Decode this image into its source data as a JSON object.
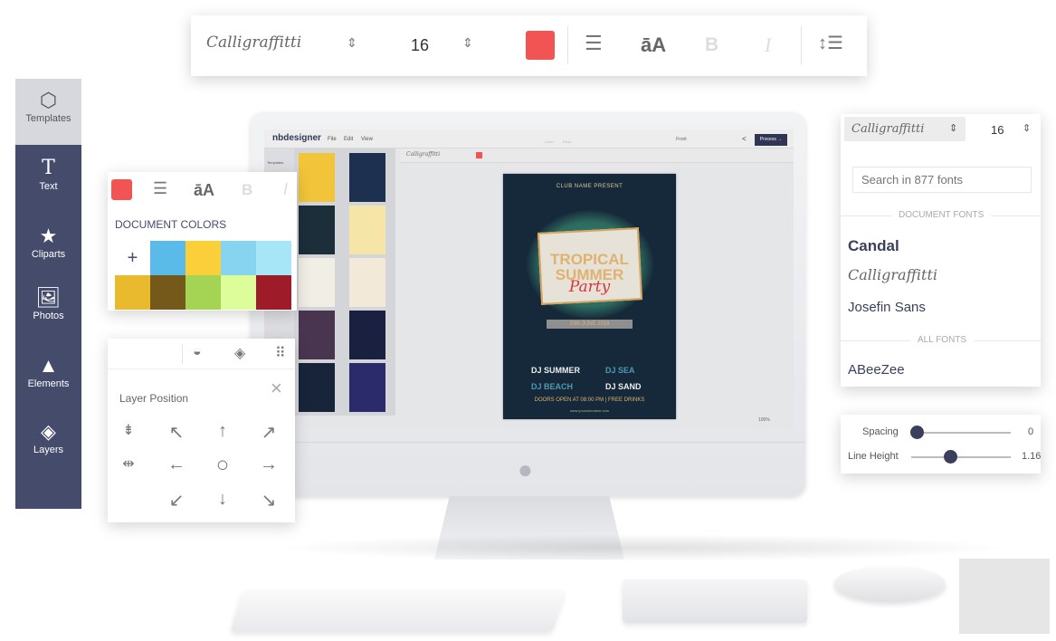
{
  "top_toolbar": {
    "font_name": "Calligraffitti",
    "font_size": "16",
    "text_color": "#f25454",
    "case_label": "āA",
    "bold_label": "B",
    "italic_label": "I",
    "icons": [
      "updown-icon",
      "align-center-icon",
      "line-height-icon"
    ]
  },
  "sidebar": {
    "items": [
      {
        "label": "Templates",
        "icon": "cube-icon",
        "active": true
      },
      {
        "label": "Text",
        "icon": "text-icon"
      },
      {
        "label": "Cliparts",
        "icon": "star-icon"
      },
      {
        "label": "Photos",
        "icon": "image-icon"
      },
      {
        "label": "Elements",
        "icon": "shapes-icon"
      },
      {
        "label": "Layers",
        "icon": "layers-icon"
      }
    ]
  },
  "color_panel": {
    "title": "DOCUMENT COLORS",
    "add_label": "+",
    "colors": [
      "#5bbbe8",
      "#fbcf3a",
      "#86d4f0",
      "#a6e6f7",
      "#e9b92e",
      "#74591b",
      "#a5d455",
      "#dcfd99",
      "#9e1b2a"
    ]
  },
  "layer_panel": {
    "title": "Layer Position",
    "close_label": "×",
    "arrows": [
      "↖",
      "↑",
      "↗",
      "←",
      "○",
      "→",
      "↙",
      "↓",
      "↘"
    ]
  },
  "app": {
    "logo": "nbdesigner",
    "menu": [
      "File",
      "Edit",
      "View"
    ],
    "undo": "Undo",
    "redo": "Redo",
    "side_label": "Front",
    "process_label": "Process →",
    "rail_label": "Templates",
    "zoom": "100%",
    "template_colors": [
      "#f2c43a",
      "#1e3050",
      "#1b2e3a",
      "#f5e6a8",
      "#f1eee6",
      "#f3e9d8",
      "#4a3550",
      "#1a2140",
      "#18243a",
      "#2b2a6b"
    ]
  },
  "poster": {
    "club": "CLUB NAME PRESENT",
    "title1": "TROPICAL",
    "title2": "SUMMER",
    "title3": "Party",
    "date": "23th JUNE 2018",
    "dj1": "DJ SUMMER",
    "dj2": "DJ SEA",
    "dj3": "DJ BEACH",
    "dj4": "DJ SAND",
    "doors": "DOORS OPEN AT 08:00 PM | FREE DRINKS",
    "url": "www.yourclubname.com"
  },
  "font_panel": {
    "font_name": "Calligraffitti",
    "font_size": "16",
    "search_placeholder": "Search in 877 fonts",
    "document_fonts_label": "DOCUMENT FONTS",
    "document_fonts": [
      "Candal",
      "Calligraffitti",
      "Josefin Sans"
    ],
    "all_fonts_label": "ALL FONTS",
    "all_fonts": [
      "ABeeZee"
    ]
  },
  "slider_panel": {
    "spacing_label": "Spacing",
    "spacing_value": "0",
    "spacing_fraction": 0,
    "line_height_label": "Line Height",
    "line_height_value": "1.16",
    "line_height_fraction": 0.39
  }
}
